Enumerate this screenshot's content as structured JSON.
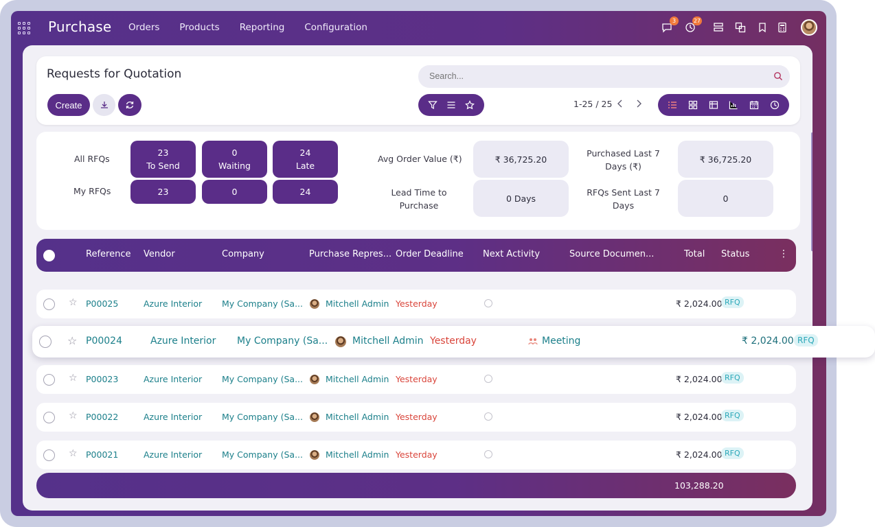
{
  "app": {
    "title": "Purchase"
  },
  "menu": [
    "Orders",
    "Products",
    "Reporting",
    "Configuration"
  ],
  "systray": {
    "messages_badge": "3",
    "activities_badge": "27"
  },
  "page": {
    "title": "Requests for Quotation",
    "create_label": "Create"
  },
  "search": {
    "placeholder": "Search..."
  },
  "pager": {
    "text": "1-25 / 25"
  },
  "dashboard": {
    "all_rfqs_label": "All RFQs",
    "my_rfqs_label": "My RFQs",
    "to_send": {
      "count": "23",
      "label": "To Send"
    },
    "waiting": {
      "count": "0",
      "label": "Waiting"
    },
    "late": {
      "count": "24",
      "label": "Late"
    },
    "my_to_send": "23",
    "my_waiting": "0",
    "my_late": "24",
    "avg_order_label": "Avg Order Value (₹)",
    "avg_order_value": "₹ 36,725.20",
    "lead_time_label_1": "Lead Time to",
    "lead_time_label_2": "Purchase",
    "lead_time_value": "0  Days",
    "purchased_label_1": "Purchased Last 7",
    "purchased_label_2": "Days (₹)",
    "purchased_value": "₹ 36,725.20",
    "rfqs_sent_label_1": "RFQs Sent Last 7",
    "rfqs_sent_label_2": "Days",
    "rfqs_sent_value": "0"
  },
  "table": {
    "columns": [
      "Reference",
      "Vendor",
      "Company",
      "Purchase Repres...",
      "Order Deadline",
      "Next Activity",
      "Source Documen...",
      "Total",
      "Status"
    ],
    "rows": [
      {
        "reference": "P00025",
        "vendor": "Azure Interior",
        "company": "My Company (Sa...",
        "rep": "Mitchell Admin",
        "deadline": "Yesterday",
        "activity": "",
        "total": "₹ 2,024.00",
        "status": "RFQ"
      },
      {
        "reference": "P00024",
        "vendor": "Azure Interior",
        "company": "My Company (Sa...",
        "rep": "Mitchell Admin",
        "deadline": "Yesterday",
        "activity": "Meeting",
        "total": "₹ 2,024.00",
        "status": "RFQ"
      },
      {
        "reference": "P00023",
        "vendor": "Azure Interior",
        "company": "My Company (Sa...",
        "rep": "Mitchell Admin",
        "deadline": "Yesterday",
        "activity": "",
        "total": "₹ 2,024.00",
        "status": "RFQ"
      },
      {
        "reference": "P00022",
        "vendor": "Azure Interior",
        "company": "My Company (Sa...",
        "rep": "Mitchell Admin",
        "deadline": "Yesterday",
        "activity": "",
        "total": "₹ 2,024.00",
        "status": "RFQ"
      },
      {
        "reference": "P00021",
        "vendor": "Azure Interior",
        "company": "My Company (Sa...",
        "rep": "Mitchell Admin",
        "deadline": "Yesterday",
        "activity": "",
        "total": "₹ 2,024.00",
        "status": "RFQ"
      }
    ],
    "footer_total": "103,288.20"
  },
  "colors": {
    "primary": "#5a2d88",
    "link": "#1b7f8a",
    "danger": "#d9443a",
    "rfq_bg": "#ddf3f6",
    "badge": "#f07a3c"
  }
}
